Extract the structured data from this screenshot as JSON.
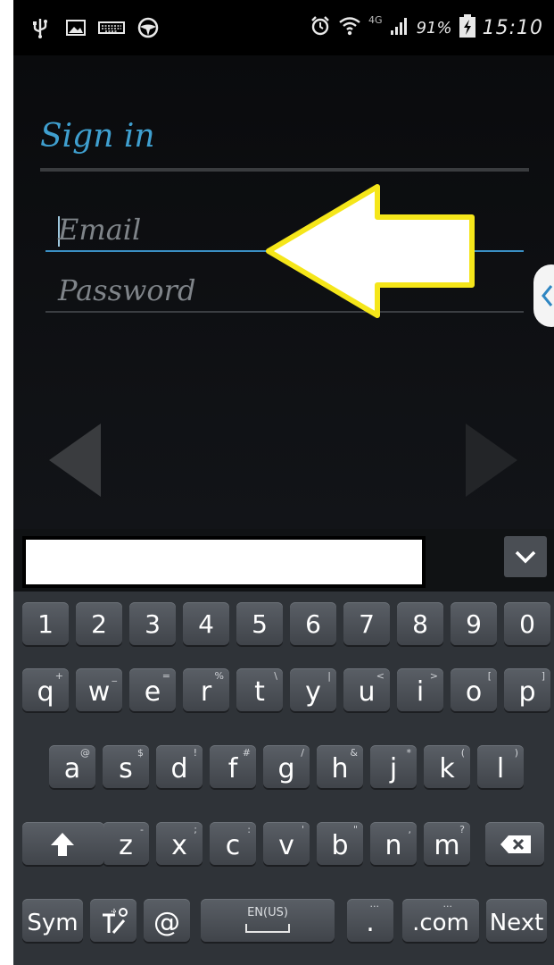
{
  "status_bar": {
    "left_icons": [
      "usb-icon",
      "image-icon",
      "keyboard-icon",
      "steering-wheel-icon"
    ],
    "right_icons": [
      "alarm-icon",
      "wifi-icon",
      "network-4g-icon",
      "signal-icon",
      "battery-charging-icon"
    ],
    "network": "4G",
    "battery": "91%",
    "time": "15:10"
  },
  "app": {
    "title": "Sign in",
    "email_placeholder": "Email",
    "password_placeholder": "Password",
    "accent_color": "#3f9fcf",
    "annotation_arrow_color": "#f5e61a"
  },
  "keyboard": {
    "number_row": [
      "1",
      "2",
      "3",
      "4",
      "5",
      "6",
      "7",
      "8",
      "9",
      "0"
    ],
    "row1": [
      {
        "label": "q",
        "hint": "+"
      },
      {
        "label": "w",
        "hint": "_"
      },
      {
        "label": "e",
        "hint": "="
      },
      {
        "label": "r",
        "hint": "%"
      },
      {
        "label": "t",
        "hint": "\\"
      },
      {
        "label": "y",
        "hint": "|"
      },
      {
        "label": "u",
        "hint": "<"
      },
      {
        "label": "i",
        "hint": ">"
      },
      {
        "label": "o",
        "hint": "["
      },
      {
        "label": "p",
        "hint": "]"
      }
    ],
    "row2": [
      {
        "label": "a",
        "hint": "@"
      },
      {
        "label": "s",
        "hint": "$"
      },
      {
        "label": "d",
        "hint": "!"
      },
      {
        "label": "f",
        "hint": "#"
      },
      {
        "label": "g",
        "hint": "/"
      },
      {
        "label": "h",
        "hint": "&"
      },
      {
        "label": "j",
        "hint": "*"
      },
      {
        "label": "k",
        "hint": "("
      },
      {
        "label": "l",
        "hint": ")"
      }
    ],
    "row3": [
      {
        "label": "z",
        "hint": "-"
      },
      {
        "label": "x",
        "hint": ";"
      },
      {
        "label": "c",
        "hint": ":"
      },
      {
        "label": "v",
        "hint": "'"
      },
      {
        "label": "b",
        "hint": "\""
      },
      {
        "label": "n",
        "hint": ","
      },
      {
        "label": "m",
        "hint": "?"
      }
    ],
    "sym_label": "Sym",
    "at_label": "@",
    "space_language": "EN(US)",
    "period_label": ".",
    "dotcom_label": ".com",
    "next_label": "Next",
    "shift_icon": "shift-arrow-icon",
    "backspace_icon": "backspace-icon",
    "handwriting_icon": "handwriting-settings-icon",
    "collapse_icon": "chevron-down-icon"
  }
}
